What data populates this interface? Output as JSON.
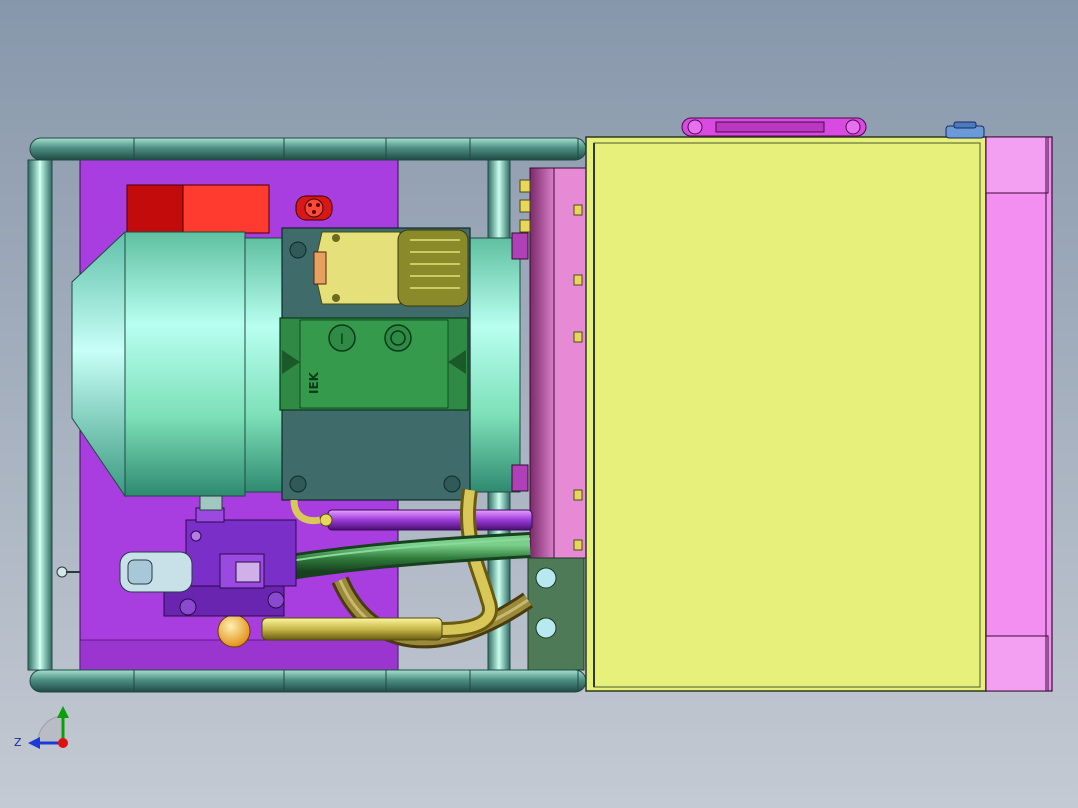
{
  "viewport": {
    "background_top": "#8797ab",
    "background_bottom": "#c4cad3"
  },
  "colors": {
    "tank": "#e6f07a",
    "tank_edge": "#3a4a2a",
    "end_plate": "#f28ff0",
    "base_plate": "#a83de0",
    "frame_tube": "#4d8f84",
    "motor_body": "#7de0b8",
    "motor_highlight": "#b8fff0",
    "junction_box": "#3f6b6a",
    "switch_box": "#2f8a45",
    "flange": "#c06ab0",
    "valve_block": "#7a2fc8",
    "hose_green": "#2f7a3a",
    "hose_brown": "#7a6a2a",
    "tube_yellow": "#c8b84a",
    "red_block_dark": "#c40b0b",
    "red_block_light": "#ff3a2e",
    "handle": "#d84ae0",
    "connector": "#d8d45a"
  },
  "switch_box": {
    "brand_text": "IEK",
    "off_symbol": "I",
    "on_symbol": "O"
  },
  "triad": {
    "z_label": "Z",
    "icons": [
      "y-axis-arrow-icon",
      "z-axis-arrow-icon",
      "origin-dot-icon"
    ]
  }
}
